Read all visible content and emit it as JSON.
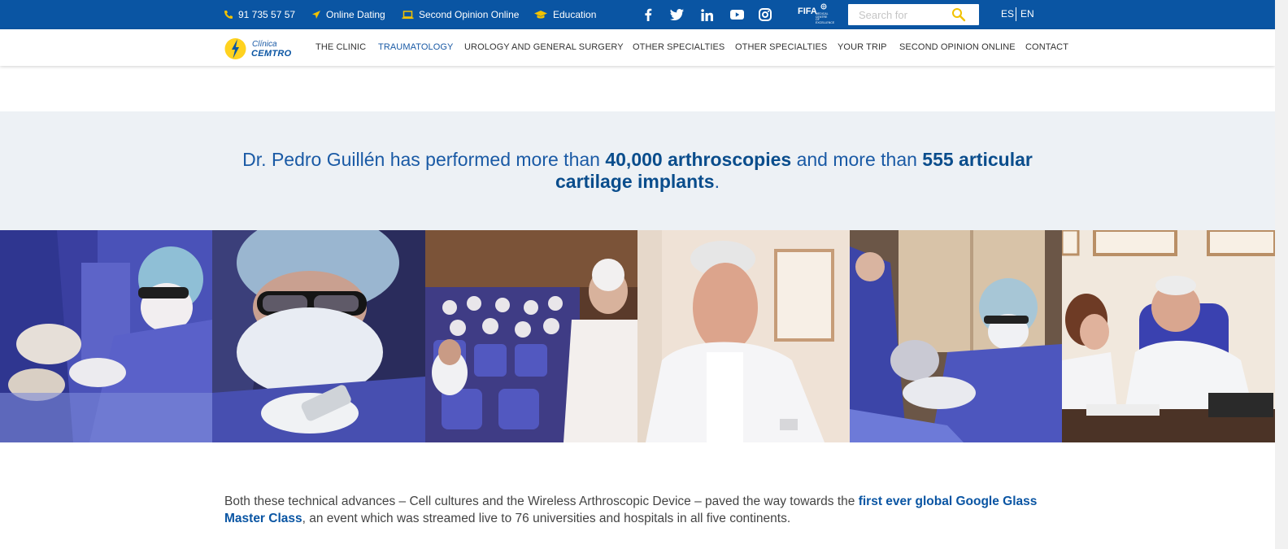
{
  "topbar": {
    "phone": "91 735 57 57",
    "online_dating": "Online Dating",
    "second_opinion": "Second Opinion Online",
    "education": "Education",
    "fifa_logo_text": "FIFA",
    "fifa_logo_sub": "MEDICAL CENTRE OF EXCELLENCE",
    "search_placeholder": "Search for",
    "lang_es": "ES",
    "lang_en": "EN"
  },
  "logo": {
    "line1": "Clínica",
    "line2": "CEMTRO"
  },
  "nav": [
    {
      "label": "THE CLINIC"
    },
    {
      "label": "TRAUMATOLOGY"
    },
    {
      "label": "UROLOGY AND GENERAL SURGERY"
    },
    {
      "label": "OTHER SPECIALTIES"
    },
    {
      "label": "OTHER SPECIALTIES"
    },
    {
      "label": "YOUR TRIP"
    },
    {
      "label": "SECOND OPINION ONLINE"
    },
    {
      "label": "CONTACT"
    }
  ],
  "quote": {
    "part1": "Dr. Pedro Guillén has performed more than ",
    "bold1": "40,000 arthroscopies",
    "part2": " and more than ",
    "bold2": "555 articular cartilage implants",
    "part3": "."
  },
  "paragraph": {
    "part1": "Both these technical advances – Cell cultures and the Wireless Arthroscopic Device – paved the way towards the ",
    "bold": "first ever global Google Glass Master Class",
    "part2": ", an event which was streamed live to 76 universities and hospitals in all five continents."
  },
  "colors": {
    "topbar": "#0a55a3",
    "accent": "#1a5aa5",
    "band": "#edf1f5",
    "search_icon": "#f2c200"
  }
}
